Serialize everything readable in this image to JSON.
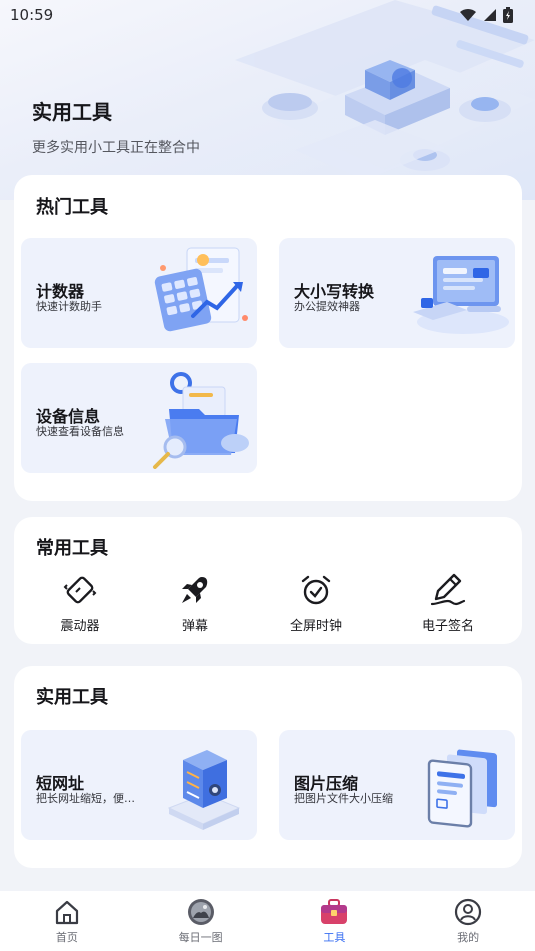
{
  "status_bar": {
    "time": "10:59"
  },
  "hero": {
    "title": "实用工具",
    "subtitle": "更多实用小工具正在整合中"
  },
  "hot_tools": {
    "title": "热门工具",
    "items": [
      {
        "name": "计数器",
        "desc": "快速计数助手",
        "icon": "calculator-chart-illustration"
      },
      {
        "name": "大小写转换",
        "desc": "办公提效神器",
        "icon": "monitor-keyboard-illustration"
      },
      {
        "name": "设备信息",
        "desc": "快速查看设备信息",
        "icon": "folder-magnifier-illustration"
      }
    ]
  },
  "common_tools": {
    "title": "常用工具",
    "items": [
      {
        "label": "震动器",
        "icon": "vibrate-icon"
      },
      {
        "label": "弹幕",
        "icon": "rocket-icon"
      },
      {
        "label": "全屏时钟",
        "icon": "alarm-clock-icon"
      },
      {
        "label": "电子签名",
        "icon": "pen-signature-icon"
      }
    ]
  },
  "utility_tools": {
    "title": "实用工具",
    "items": [
      {
        "name": "短网址",
        "desc": "把长网址缩短，便…",
        "icon": "server-stack-illustration"
      },
      {
        "name": "图片压缩",
        "desc": "把图片文件大小压缩",
        "icon": "image-docs-illustration"
      }
    ]
  },
  "tabbar": {
    "items": [
      {
        "label": "首页",
        "icon": "home-icon",
        "active": false
      },
      {
        "label": "每日一图",
        "icon": "daily-photo-icon",
        "active": false
      },
      {
        "label": "工具",
        "icon": "toolbox-icon",
        "active": true
      },
      {
        "label": "我的",
        "icon": "profile-icon",
        "active": false
      }
    ]
  },
  "colors": {
    "accent": "#3a6ff2",
    "tile_bg": "#eef2fc",
    "page_bg": "#f1f3f8"
  }
}
